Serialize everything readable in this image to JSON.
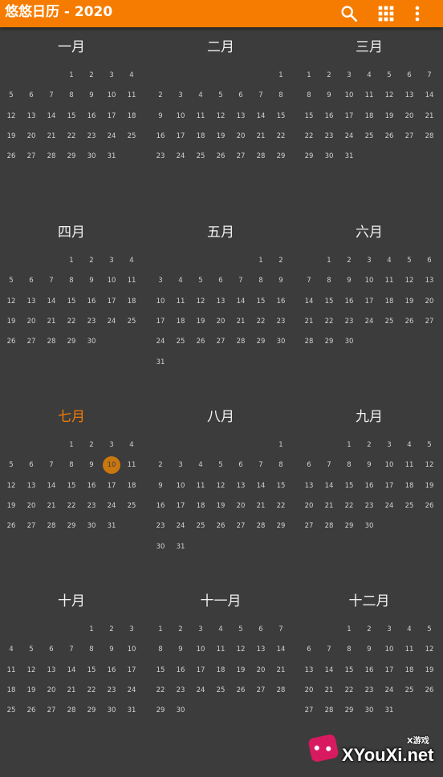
{
  "app": {
    "title": "悠悠日历 - 2020",
    "actions": [
      {
        "name": "search-button",
        "icon": "search-icon"
      },
      {
        "name": "grid-view-button",
        "icon": "grid-icon"
      },
      {
        "name": "more-options-button",
        "icon": "more-vert-icon"
      }
    ],
    "accent_color": "#f57c00",
    "background_color": "#3c3c3c"
  },
  "year": 2020,
  "today": {
    "month_index": 6,
    "day": "10"
  },
  "months": [
    {
      "name": "一月",
      "weeks": [
        [
          "",
          "",
          "",
          "1",
          "2",
          "3",
          "4"
        ],
        [
          "5",
          "6",
          "7",
          "8",
          "9",
          "10",
          "11"
        ],
        [
          "12",
          "13",
          "14",
          "15",
          "16",
          "17",
          "18"
        ],
        [
          "19",
          "20",
          "21",
          "22",
          "23",
          "24",
          "25"
        ],
        [
          "26",
          "27",
          "28",
          "29",
          "30",
          "31",
          ""
        ]
      ]
    },
    {
      "name": "二月",
      "weeks": [
        [
          "",
          "",
          "",
          "",
          "",
          "",
          "1"
        ],
        [
          "2",
          "3",
          "4",
          "5",
          "6",
          "7",
          "8"
        ],
        [
          "9",
          "10",
          "11",
          "12",
          "13",
          "14",
          "15"
        ],
        [
          "16",
          "17",
          "18",
          "19",
          "20",
          "21",
          "22"
        ],
        [
          "23",
          "24",
          "25",
          "26",
          "27",
          "28",
          "29"
        ]
      ]
    },
    {
      "name": "三月",
      "weeks": [
        [
          "1",
          "2",
          "3",
          "4",
          "5",
          "6",
          "7"
        ],
        [
          "8",
          "9",
          "10",
          "11",
          "12",
          "13",
          "14"
        ],
        [
          "15",
          "16",
          "17",
          "18",
          "19",
          "20",
          "21"
        ],
        [
          "22",
          "23",
          "24",
          "25",
          "26",
          "27",
          "28"
        ],
        [
          "29",
          "30",
          "31",
          "",
          "",
          "",
          ""
        ]
      ]
    },
    {
      "name": "四月",
      "weeks": [
        [
          "",
          "",
          "",
          "1",
          "2",
          "3",
          "4"
        ],
        [
          "5",
          "6",
          "7",
          "8",
          "9",
          "10",
          "11"
        ],
        [
          "12",
          "13",
          "14",
          "15",
          "16",
          "17",
          "18"
        ],
        [
          "19",
          "20",
          "21",
          "22",
          "23",
          "24",
          "25"
        ],
        [
          "26",
          "27",
          "28",
          "29",
          "30",
          "",
          ""
        ]
      ]
    },
    {
      "name": "五月",
      "weeks": [
        [
          "",
          "",
          "",
          "",
          "",
          "1",
          "2"
        ],
        [
          "3",
          "4",
          "5",
          "6",
          "7",
          "8",
          "9"
        ],
        [
          "10",
          "11",
          "12",
          "13",
          "14",
          "15",
          "16"
        ],
        [
          "17",
          "18",
          "19",
          "20",
          "21",
          "22",
          "23"
        ],
        [
          "24",
          "25",
          "26",
          "27",
          "28",
          "29",
          "30"
        ],
        [
          "31",
          "",
          "",
          "",
          "",
          "",
          ""
        ]
      ]
    },
    {
      "name": "六月",
      "weeks": [
        [
          "",
          "1",
          "2",
          "3",
          "4",
          "5",
          "6"
        ],
        [
          "7",
          "8",
          "9",
          "10",
          "11",
          "12",
          "13"
        ],
        [
          "14",
          "15",
          "16",
          "17",
          "18",
          "19",
          "20"
        ],
        [
          "21",
          "22",
          "23",
          "24",
          "25",
          "26",
          "27"
        ],
        [
          "28",
          "29",
          "30",
          "",
          "",
          "",
          ""
        ]
      ]
    },
    {
      "name": "七月",
      "weeks": [
        [
          "",
          "",
          "",
          "1",
          "2",
          "3",
          "4"
        ],
        [
          "5",
          "6",
          "7",
          "8",
          "9",
          "10",
          "11"
        ],
        [
          "12",
          "13",
          "14",
          "15",
          "16",
          "17",
          "18"
        ],
        [
          "19",
          "20",
          "21",
          "22",
          "23",
          "24",
          "25"
        ],
        [
          "26",
          "27",
          "28",
          "29",
          "30",
          "31",
          ""
        ]
      ]
    },
    {
      "name": "八月",
      "weeks": [
        [
          "",
          "",
          "",
          "",
          "",
          "",
          "1"
        ],
        [
          "2",
          "3",
          "4",
          "5",
          "6",
          "7",
          "8"
        ],
        [
          "9",
          "10",
          "11",
          "12",
          "13",
          "14",
          "15"
        ],
        [
          "16",
          "17",
          "18",
          "19",
          "20",
          "21",
          "22"
        ],
        [
          "23",
          "24",
          "25",
          "26",
          "27",
          "28",
          "29"
        ],
        [
          "30",
          "31",
          "",
          "",
          "",
          "",
          ""
        ]
      ]
    },
    {
      "name": "九月",
      "weeks": [
        [
          "",
          "",
          "1",
          "2",
          "3",
          "4",
          "5"
        ],
        [
          "6",
          "7",
          "8",
          "9",
          "10",
          "11",
          "12"
        ],
        [
          "13",
          "14",
          "15",
          "16",
          "17",
          "18",
          "19"
        ],
        [
          "20",
          "21",
          "22",
          "23",
          "24",
          "25",
          "26"
        ],
        [
          "27",
          "28",
          "29",
          "30",
          "",
          "",
          ""
        ]
      ]
    },
    {
      "name": "十月",
      "weeks": [
        [
          "",
          "",
          "",
          "",
          "1",
          "2",
          "3"
        ],
        [
          "4",
          "5",
          "6",
          "7",
          "8",
          "9",
          "10"
        ],
        [
          "11",
          "12",
          "13",
          "14",
          "15",
          "16",
          "17"
        ],
        [
          "18",
          "19",
          "20",
          "21",
          "22",
          "23",
          "24"
        ],
        [
          "25",
          "26",
          "27",
          "28",
          "29",
          "30",
          "31"
        ]
      ]
    },
    {
      "name": "十一月",
      "weeks": [
        [
          "1",
          "2",
          "3",
          "4",
          "5",
          "6",
          "7"
        ],
        [
          "8",
          "9",
          "10",
          "11",
          "12",
          "13",
          "14"
        ],
        [
          "15",
          "16",
          "17",
          "18",
          "19",
          "20",
          "21"
        ],
        [
          "22",
          "23",
          "24",
          "25",
          "26",
          "27",
          "28"
        ],
        [
          "29",
          "30",
          "",
          "",
          "",
          "",
          ""
        ]
      ]
    },
    {
      "name": "十二月",
      "weeks": [
        [
          "",
          "",
          "1",
          "2",
          "3",
          "4",
          "5"
        ],
        [
          "6",
          "7",
          "8",
          "9",
          "10",
          "11",
          "12"
        ],
        [
          "13",
          "14",
          "15",
          "16",
          "17",
          "18",
          "19"
        ],
        [
          "20",
          "21",
          "22",
          "23",
          "24",
          "25",
          "26"
        ],
        [
          "27",
          "28",
          "29",
          "30",
          "31",
          "",
          ""
        ]
      ]
    }
  ],
  "watermark": {
    "small_text": "X游戏",
    "main_text": "XYouXi.net"
  }
}
